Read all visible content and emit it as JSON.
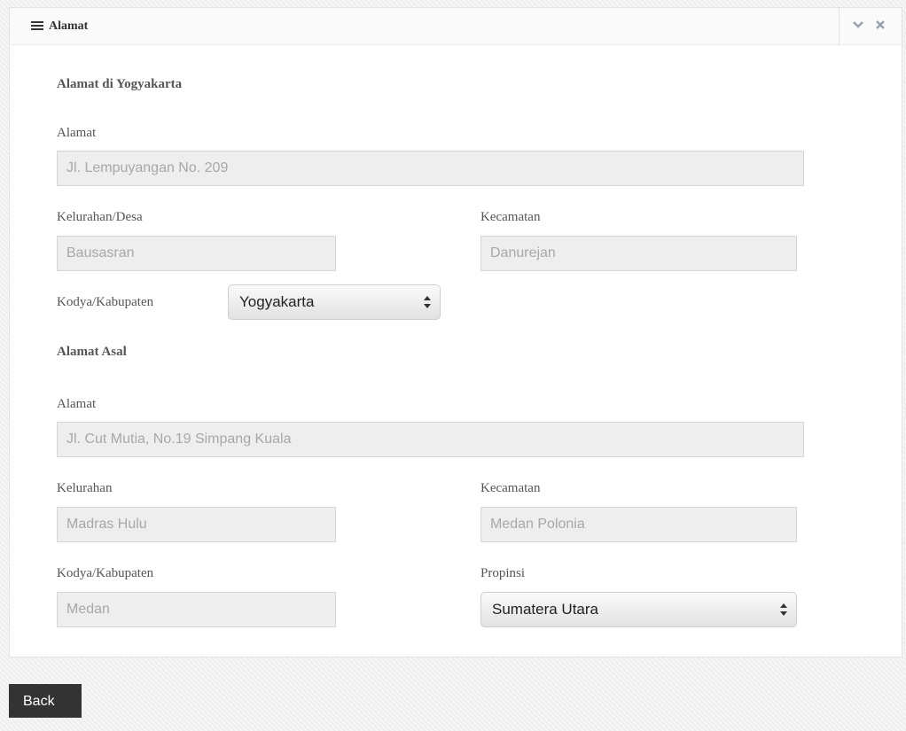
{
  "panel": {
    "title": "Alamat",
    "icons": {
      "menu": "hamburger-icon",
      "collapse": "chevron-down-icon",
      "close": "close-icon"
    },
    "collapse_glyph": "✓",
    "close_glyph": "✕"
  },
  "yogyakarta": {
    "heading": "Alamat di Yogyakarta",
    "alamat_label": "Alamat",
    "alamat_value": "Jl. Lempuyangan No. 209",
    "kelurahan_label": "Kelurahan/Desa",
    "kelurahan_value": "Bausasran",
    "kecamatan_label": "Kecamatan",
    "kecamatan_value": "Danurejan",
    "kodya_label": "Kodya/Kabupaten",
    "kodya_selected": "Yogyakarta"
  },
  "asal": {
    "heading": "Alamat Asal",
    "alamat_label": "Alamat",
    "alamat_value": "Jl. Cut Mutia, No.19 Simpang Kuala",
    "kelurahan_label": "Kelurahan",
    "kelurahan_value": "Madras Hulu",
    "kecamatan_label": "Kecamatan",
    "kecamatan_value": "Medan Polonia",
    "kodya_label": "Kodya/Kabupaten",
    "kodya_value": "Medan",
    "propinsi_label": "Propinsi",
    "propinsi_selected": "Sumatera Utara"
  },
  "footer": {
    "back_label": "Back"
  },
  "colors": {
    "panel_background": "#ffffff",
    "input_background": "#eeeeee",
    "input_text": "#a8a8a8",
    "back_button": "#333333"
  }
}
